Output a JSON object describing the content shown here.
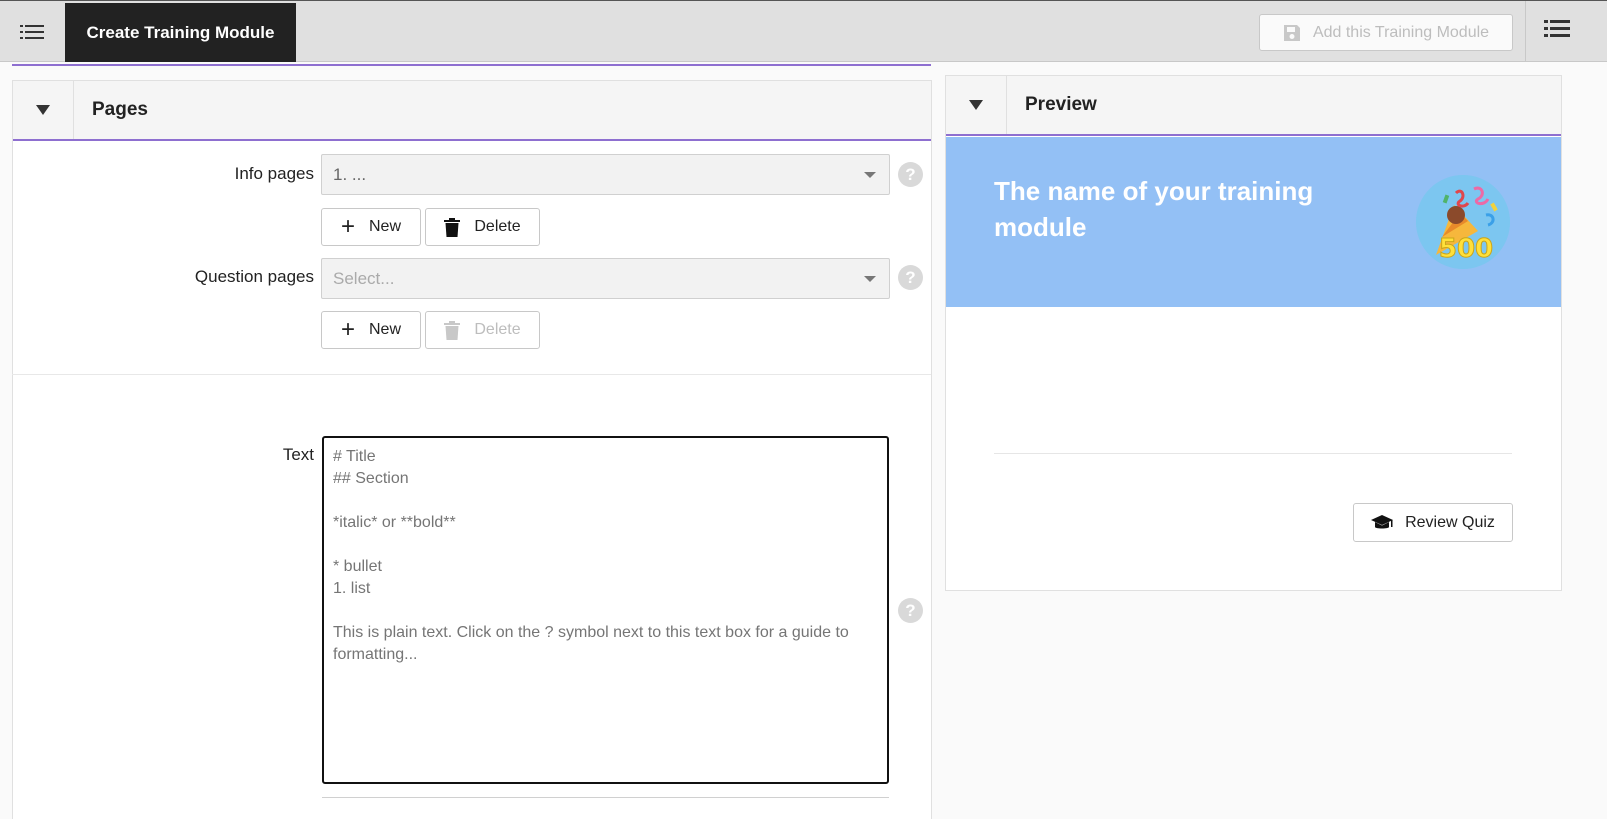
{
  "topbar": {
    "menu_icon": "list-icon",
    "active_tab": "Create Training Module",
    "add_button_label": "Add this Training Module",
    "add_button_icon": "save-icon",
    "right_menu_icon": "list-icon"
  },
  "pages_panel": {
    "title": "Pages",
    "info_pages": {
      "label": "Info pages",
      "selected": "1. ...",
      "new_label": "New",
      "delete_label": "Delete"
    },
    "question_pages": {
      "label": "Question pages",
      "placeholder": "Select...",
      "new_label": "New",
      "delete_label": "Delete"
    },
    "help_glyph": "?",
    "text_field": {
      "label": "Text",
      "placeholder": "# Title\n## Section\n\n*italic* or **bold**\n\n* bullet\n1. list\n\nThis is plain text. Click on the ? symbol next to this text box for a guide to formatting..."
    }
  },
  "preview_panel": {
    "title": "Preview",
    "module_name": "The name of your training module",
    "badge_number": "500",
    "review_button_label": "Review Quiz",
    "review_button_icon": "graduation-cap-icon"
  },
  "colors": {
    "accent": "#8e6fd0",
    "banner": "#93c0f5",
    "tab_active_bg": "#222222"
  }
}
